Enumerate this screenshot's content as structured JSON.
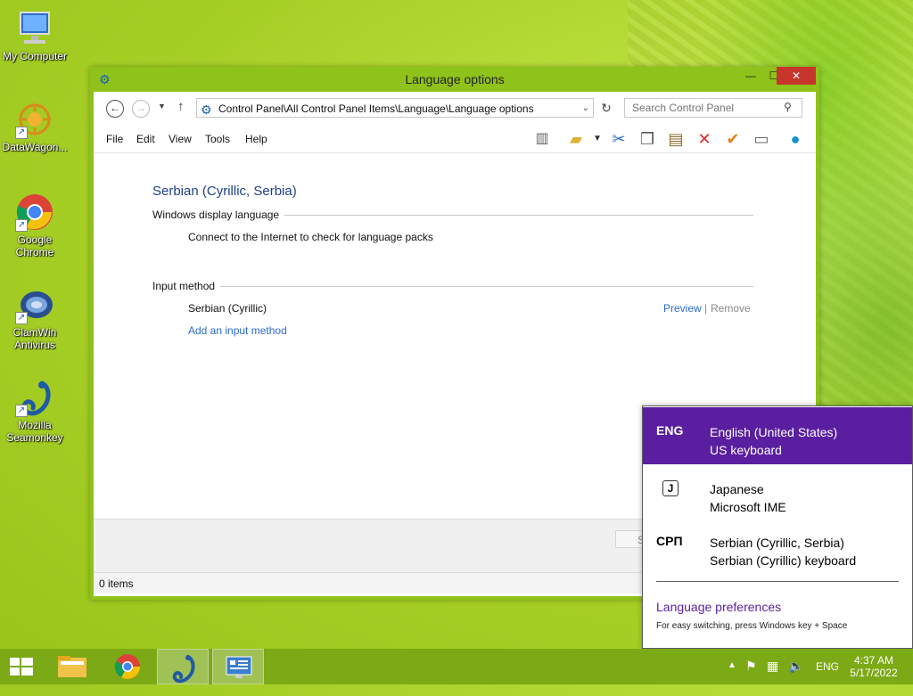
{
  "desktop": {
    "icons": [
      {
        "label": "My Computer",
        "icon": "computer-icon"
      },
      {
        "label": "DataWagon...",
        "icon": "datawagon-icon"
      },
      {
        "label": "Google Chrome",
        "icon": "chrome-icon"
      },
      {
        "label": "ClamWin Antivirus",
        "icon": "clamwin-icon"
      },
      {
        "label": "Mozilla Seamonkey",
        "icon": "seamonkey-icon"
      }
    ]
  },
  "window": {
    "title": "Language options",
    "address": "Control Panel\\All Control Panel Items\\Language\\Language options",
    "search_placeholder": "Search Control Panel",
    "menu": [
      "File",
      "Edit",
      "View",
      "Tools",
      "Help"
    ],
    "toolbar_icons": [
      "layout-icon",
      "folder-icon",
      "cut-icon",
      "copy-icon",
      "paste-icon",
      "delete-icon",
      "check-icon",
      "properties-icon",
      "globe-icon"
    ],
    "language_title": "Serbian (Cyrillic, Serbia)",
    "display_language_header": "Windows display language",
    "display_language_text": "Connect to the Internet to check for language packs",
    "input_method_header": "Input method",
    "input_method_name": "Serbian (Cyrillic)",
    "preview_link": "Preview",
    "link_separator": "|",
    "remove_link": "Remove",
    "add_input_link": "Add an input method",
    "save_button": "S",
    "status": "0 items"
  },
  "flyout": {
    "items": [
      {
        "abbr": "ENG",
        "name": "English (United States)",
        "detail": "US keyboard"
      },
      {
        "abbr": "",
        "name": "Japanese",
        "detail": "Microsoft IME"
      },
      {
        "abbr": "СРП",
        "name": "Serbian (Cyrillic, Serbia)",
        "detail": "Serbian (Cyrillic) keyboard"
      }
    ],
    "ime_glyph": "J",
    "preferences_link": "Language preferences",
    "hint": "For easy switching, press Windows key + Space"
  },
  "taskbar": {
    "tray_lang": "ENG",
    "time": "4:37 AM",
    "date": "5/17/2022"
  },
  "colors": {
    "accent": "#8fc21a",
    "flyout_active": "#5a1fa0",
    "link": "#2a6bd0"
  }
}
